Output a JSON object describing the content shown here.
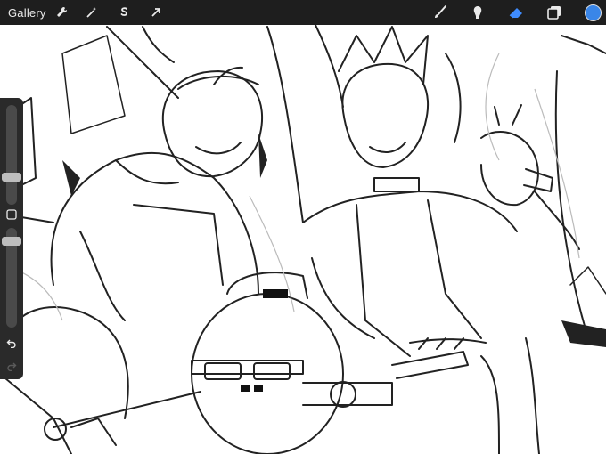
{
  "app": {
    "gallery_label": "Gallery"
  },
  "toolbar": {
    "left_tools": [
      "wrench-icon",
      "magic-wand-icon",
      "selection-s-icon",
      "transform-arrow-icon"
    ],
    "right_tools": [
      "brush-icon",
      "smudge-icon",
      "eraser-icon",
      "layers-icon",
      "color-icon"
    ],
    "active_tool": "eraser",
    "accent": "#3f8cff",
    "current_color": "#3a86e8"
  },
  "sidebar": {
    "size_slider_level": 0.25,
    "opacity_slider_level": 0.75,
    "buttons": [
      "modify-square-icon",
      "undo-icon",
      "redo-icon"
    ]
  },
  "canvas": {
    "content": "line-art-illustration"
  }
}
